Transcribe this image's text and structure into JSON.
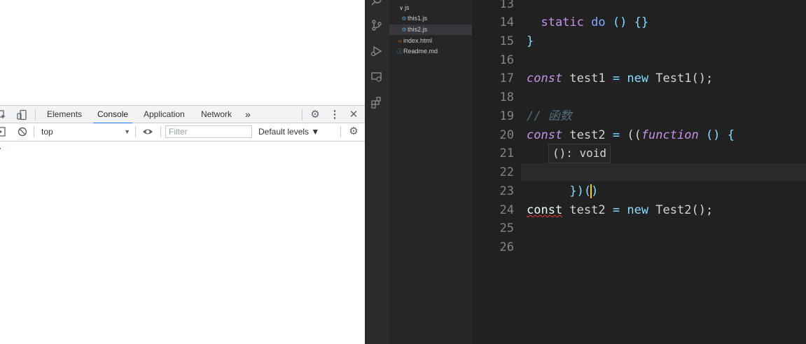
{
  "devtools": {
    "tabs": [
      "Elements",
      "Console",
      "Application",
      "Network"
    ],
    "more_tabs": "»",
    "active_tab": "Console",
    "context": "top",
    "filter_placeholder": "Filter",
    "levels": "Default levels ▼",
    "prompt": "›"
  },
  "explorer": {
    "items": [
      {
        "label": "js",
        "type": "folder",
        "expanded": true
      },
      {
        "label": "this1.js",
        "type": "js"
      },
      {
        "label": "this2.js",
        "type": "js",
        "selected": true
      },
      {
        "label": "index.html",
        "type": "html"
      },
      {
        "label": "Readme.md",
        "type": "md"
      }
    ]
  },
  "editor": {
    "line_numbers": [
      "13",
      "14",
      "15",
      "16",
      "17",
      "18",
      "19",
      "20",
      "21",
      "22",
      "23",
      "24",
      "25",
      "26"
    ],
    "lines": {
      "l14": [
        {
          "t": "  "
        },
        {
          "t": "static",
          "c": "kw"
        },
        {
          "t": " "
        },
        {
          "t": "do",
          "c": "fn"
        },
        {
          "t": " "
        },
        {
          "t": "()",
          "c": "pn"
        },
        {
          "t": " "
        },
        {
          "t": "{}",
          "c": "pn"
        }
      ],
      "l15": [
        {
          "t": "}",
          "c": "pn"
        }
      ],
      "l17": [
        {
          "t": "const",
          "c": "kw-i"
        },
        {
          "t": " test1 "
        },
        {
          "t": "=",
          "c": "pn"
        },
        {
          "t": " "
        },
        {
          "t": "new",
          "c": "pn"
        },
        {
          "t": " Test1();"
        }
      ],
      "l19": [
        {
          "t": "// 函数",
          "c": "cm"
        }
      ],
      "l20": [
        {
          "t": "const",
          "c": "kw-i"
        },
        {
          "t": " test2 "
        },
        {
          "t": "=",
          "c": "pn"
        },
        {
          "t": " (("
        },
        {
          "t": "function",
          "c": "kw-i"
        },
        {
          "t": " "
        },
        {
          "t": "()",
          "c": "pn"
        },
        {
          "t": " "
        },
        {
          "t": "{",
          "c": "pn"
        }
      ],
      "l22a": "})(",
      "l22b": ")",
      "l24": [
        {
          "t": "const",
          "c": "nm err"
        },
        {
          "t": " test2 "
        },
        {
          "t": "=",
          "c": "pn"
        },
        {
          "t": " "
        },
        {
          "t": "new",
          "c": "pn"
        },
        {
          "t": " Test2();"
        }
      ]
    },
    "hover_text": "(): void"
  }
}
